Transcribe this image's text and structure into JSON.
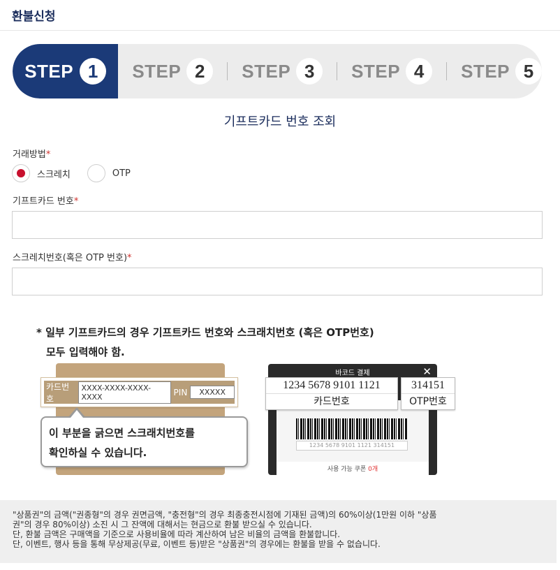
{
  "header": {
    "title": "환불신청"
  },
  "steps": {
    "word": "STEP",
    "items": [
      {
        "num": "1",
        "active": true
      },
      {
        "num": "2",
        "active": false
      },
      {
        "num": "3",
        "active": false
      },
      {
        "num": "4",
        "active": false
      },
      {
        "num": "5",
        "active": false
      }
    ]
  },
  "section_title": "기프트카드 번호 조회",
  "form": {
    "method_label": "거래방법",
    "required_mark": "*",
    "method_options": [
      {
        "label": "스크레치",
        "selected": true
      },
      {
        "label": "OTP",
        "selected": false
      }
    ],
    "card_number_label": "기프트카드 번호",
    "card_number_value": "",
    "scratch_label": "스크레치번호(혹은 OTP 번호)",
    "scratch_value": ""
  },
  "notice": {
    "line1": "* 일부 기프트카드의 경우 기프트카드 번호와 스크래치번호 (혹은 OTP번호)",
    "line2": "모두 입력해야 함."
  },
  "card_illustration": {
    "card_label": "카드번호",
    "card_mask": "XXXX-XXXX-XXXX-XXXX",
    "pin_label": "PIN",
    "pin_mask": "XXXXX",
    "bubble_line1": "이 부분을 긁으면 스크래치번호를",
    "bubble_line2": "확인하실 수 있습니다."
  },
  "phone_illustration": {
    "header": "바코드 결제",
    "close": "✕",
    "barcode_digits": "1234 5678 9101 1121 314151",
    "card_number": "1234  5678  9101  1121",
    "card_caption": "카드번호",
    "otp_number": "314151",
    "otp_caption": "OTP번호",
    "bottom_text": "사용 가능 쿠폰",
    "bottom_count": "0개"
  },
  "footer": {
    "lines": [
      "\"상품권\"의 금액(\"권종형\"의 경우 권면금액, \"충전형\"의 경우 최종충전시점에 기재된 금액)의 60%이상(1만원 이하 \"상품",
      "권\"의 경우 80%이상) 소진 시 그 잔액에 대해서는 현금으로 환불 받으실 수 있습니다.",
      "단, 환불 금액은 구매액을 기준으로 사용비율에 따라 계산하여 남은 비율의 금액을 환불합니다.",
      "단, 이벤트, 행사 등을 통해 무상제공(무료, 이벤트 등)받은 \"상품권\"의 경우에는 환불을 받을 수 없습니다."
    ]
  },
  "colors": {
    "navy": "#1b3a78",
    "required": "#d0312d",
    "radio_selected": "#c8102e"
  }
}
